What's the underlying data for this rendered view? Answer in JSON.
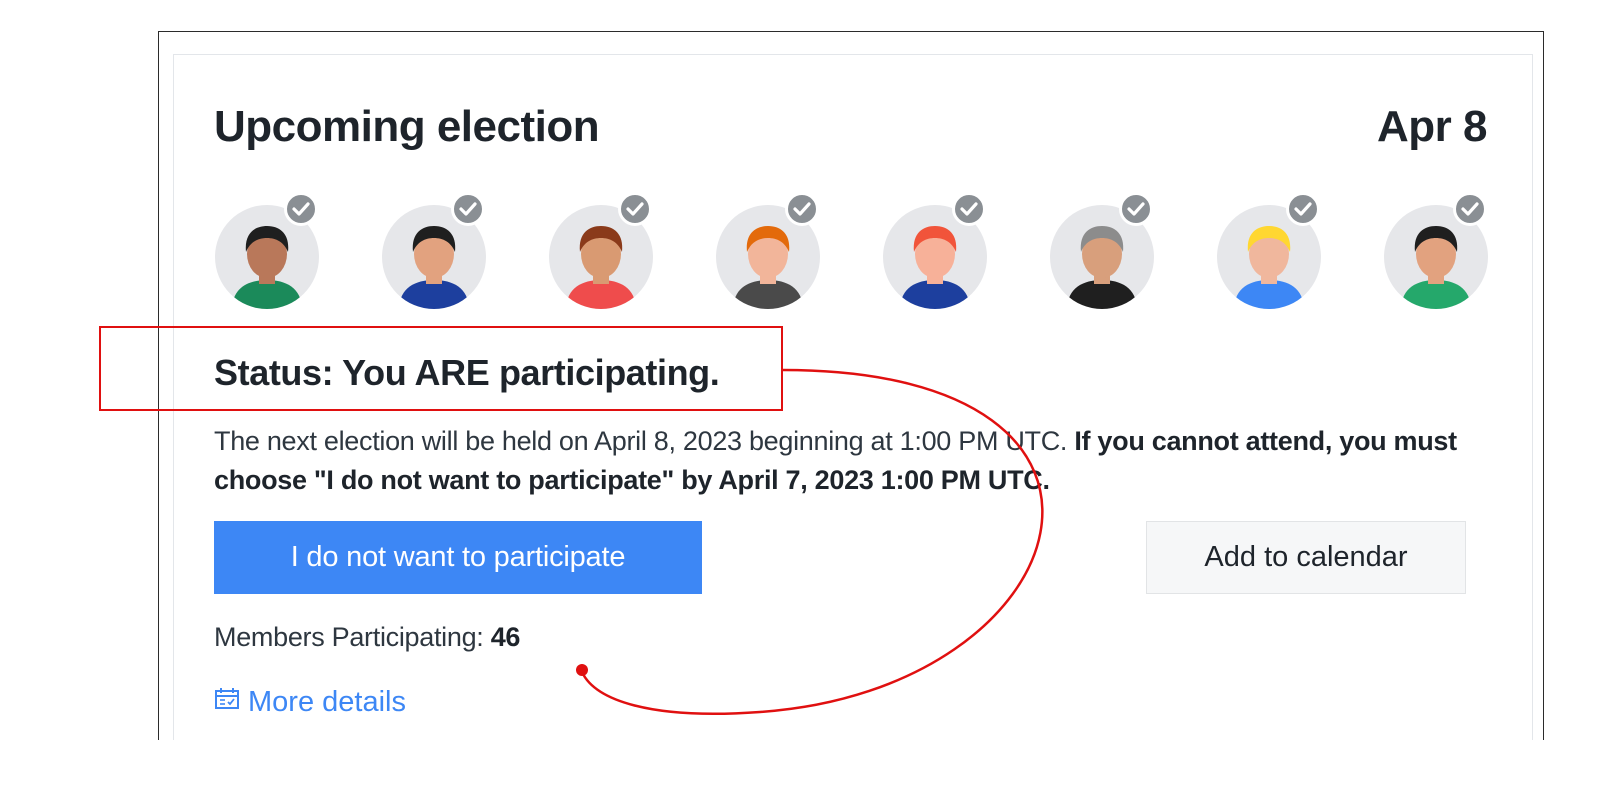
{
  "election": {
    "title": "Upcoming election",
    "date": "Apr 8",
    "status": "Status: You ARE participating.",
    "description_normal": "The next election will be held on April 8, 2023 beginning at 1:00 PM UTC. ",
    "description_bold": "If you cannot attend, you must choose \"I do not want to participate\" by April 7, 2023 1:00 PM UTC.",
    "primary_button": "I do not want to participate",
    "secondary_button": "Add to calendar",
    "members_label": "Members Participating: ",
    "members_count": "46",
    "more_details": "More details"
  },
  "avatars": [
    {
      "skin": "#b9785a",
      "hair": "#1f1f1f",
      "shirt": "#1b8a5a"
    },
    {
      "skin": "#e2a27f",
      "hair": "#1f1f1f",
      "shirt": "#1d3f9e"
    },
    {
      "skin": "#d99a72",
      "hair": "#8a3a1a",
      "shirt": "#ef4c4c"
    },
    {
      "skin": "#f2b59a",
      "hair": "#e36a0b",
      "shirt": "#4a4a4a"
    },
    {
      "skin": "#f7b199",
      "hair": "#f1543a",
      "shirt": "#1d3f9e"
    },
    {
      "skin": "#d89f7c",
      "hair": "#8c8c8c",
      "shirt": "#1f1f1f"
    },
    {
      "skin": "#f0b79d",
      "hair": "#ffd731",
      "shirt": "#3d87f5"
    },
    {
      "skin": "#e2a27f",
      "hair": "#1f1f1f",
      "shirt": "#25a86b"
    }
  ],
  "colors": {
    "accent": "#3d87f5",
    "annotation": "#e01010",
    "check_badge": "#8a8f94"
  }
}
